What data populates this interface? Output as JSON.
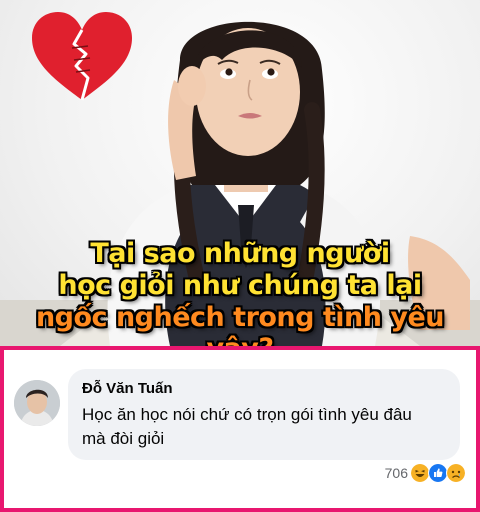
{
  "meme": {
    "caption_line_1": "Tại sao những người",
    "caption_line_2": "học giỏi như chúng ta lại",
    "caption_line_3": "ngốc nghếch trong tình yêu vậy?",
    "colors": {
      "caption_yellow": "#ffe233",
      "caption_orange": "#ff8a1f",
      "heart": "#e0202e"
    },
    "icons": [
      "broken-heart-icon"
    ]
  },
  "comment": {
    "author": "Đỗ Văn Tuấn",
    "text_line_1": "Học ăn học nói chứ có trọn gói tình yêu đâu",
    "text_line_2": "mà đòi giỏi",
    "reaction_count": "706",
    "reaction_icons": [
      "haha-icon",
      "like-icon",
      "sad-icon"
    ]
  },
  "colors": {
    "frame": "#e8176f",
    "bubble": "#f0f2f5",
    "like": "#1877f2",
    "haha": "#f7b125"
  }
}
